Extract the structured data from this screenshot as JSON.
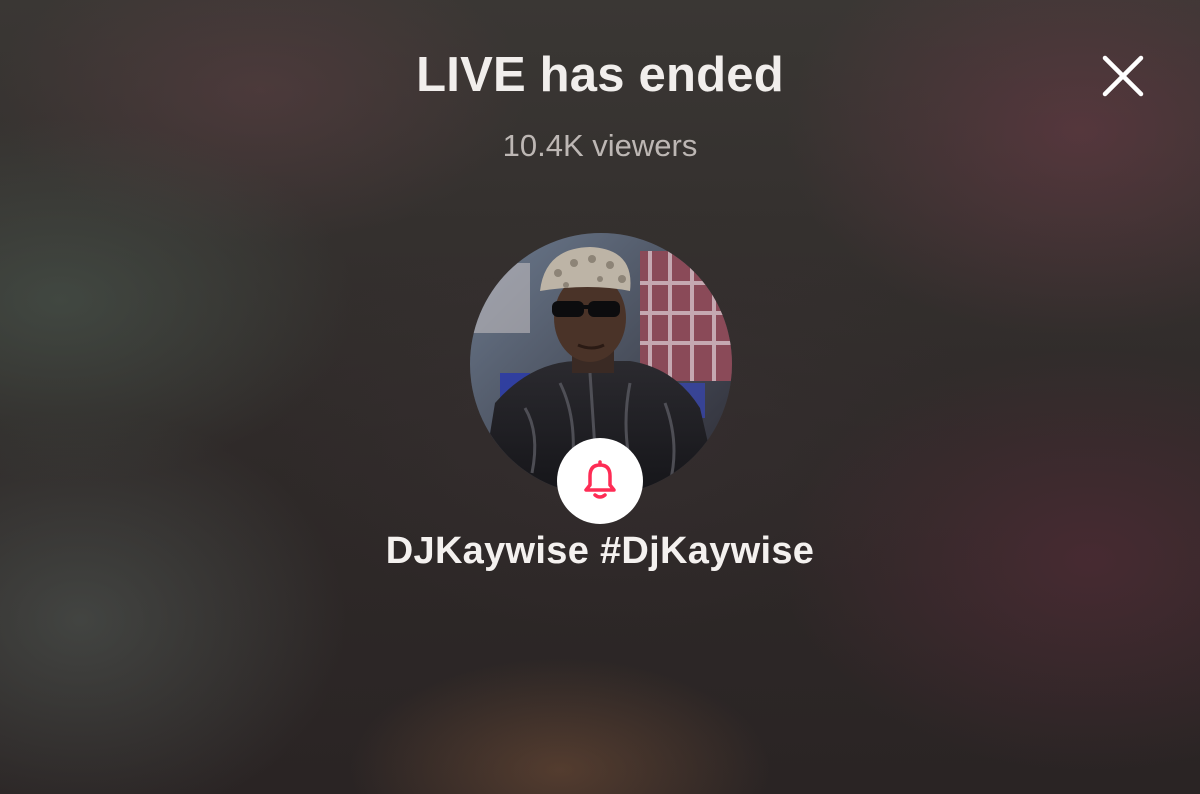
{
  "live_end": {
    "title": "LIVE has ended",
    "viewers": "10.4K viewers"
  },
  "host": {
    "name": "DJKaywise #DjKaywise"
  },
  "icons": {
    "close": "close-icon",
    "notify": "bell-icon"
  },
  "colors": {
    "accent": "#fe2c55",
    "title": "#f1eeec",
    "subtitle": "#bdb7b4"
  }
}
